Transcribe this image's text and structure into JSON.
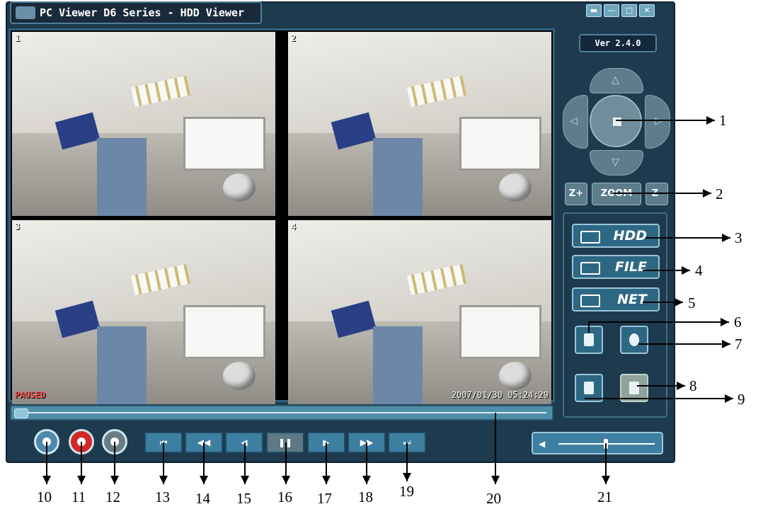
{
  "window": {
    "title": "PC Viewer D6 Series - HDD Viewer",
    "version": "Ver 2.4.0",
    "controls": [
      "pin",
      "minimize",
      "maximize",
      "close"
    ]
  },
  "viewer": {
    "channels": [
      {
        "number": "1"
      },
      {
        "number": "2"
      },
      {
        "number": "3",
        "status": "PAUSED"
      },
      {
        "number": "4",
        "timestamp": "2007/01/30 05:24:29"
      }
    ]
  },
  "ptz": {
    "center_icon": "grid-icon",
    "zoom_in_label": "Z+",
    "zoom_label": "ZOOM",
    "zoom_out_label": "Z-"
  },
  "modes": {
    "hdd": "HDD",
    "file": "FILE",
    "net": "NET"
  },
  "tools": [
    "log-icon",
    "settings-fan-icon",
    "backup-icon",
    "config-icon"
  ],
  "playback": {
    "buttons": [
      "skip-start",
      "fast-back",
      "step-back",
      "pause",
      "play",
      "fast-forward",
      "skip-end"
    ],
    "circle_buttons": [
      "snapshot",
      "record",
      "tools"
    ]
  },
  "callouts": [
    "1",
    "2",
    "3",
    "4",
    "5",
    "6",
    "7",
    "8",
    "9",
    "10",
    "11",
    "12",
    "13",
    "14",
    "15",
    "16",
    "17",
    "18",
    "19",
    "20",
    "21"
  ],
  "colors": {
    "frame": "#1d3a4e",
    "accent": "#3d7fa0",
    "record": "#d32828"
  }
}
